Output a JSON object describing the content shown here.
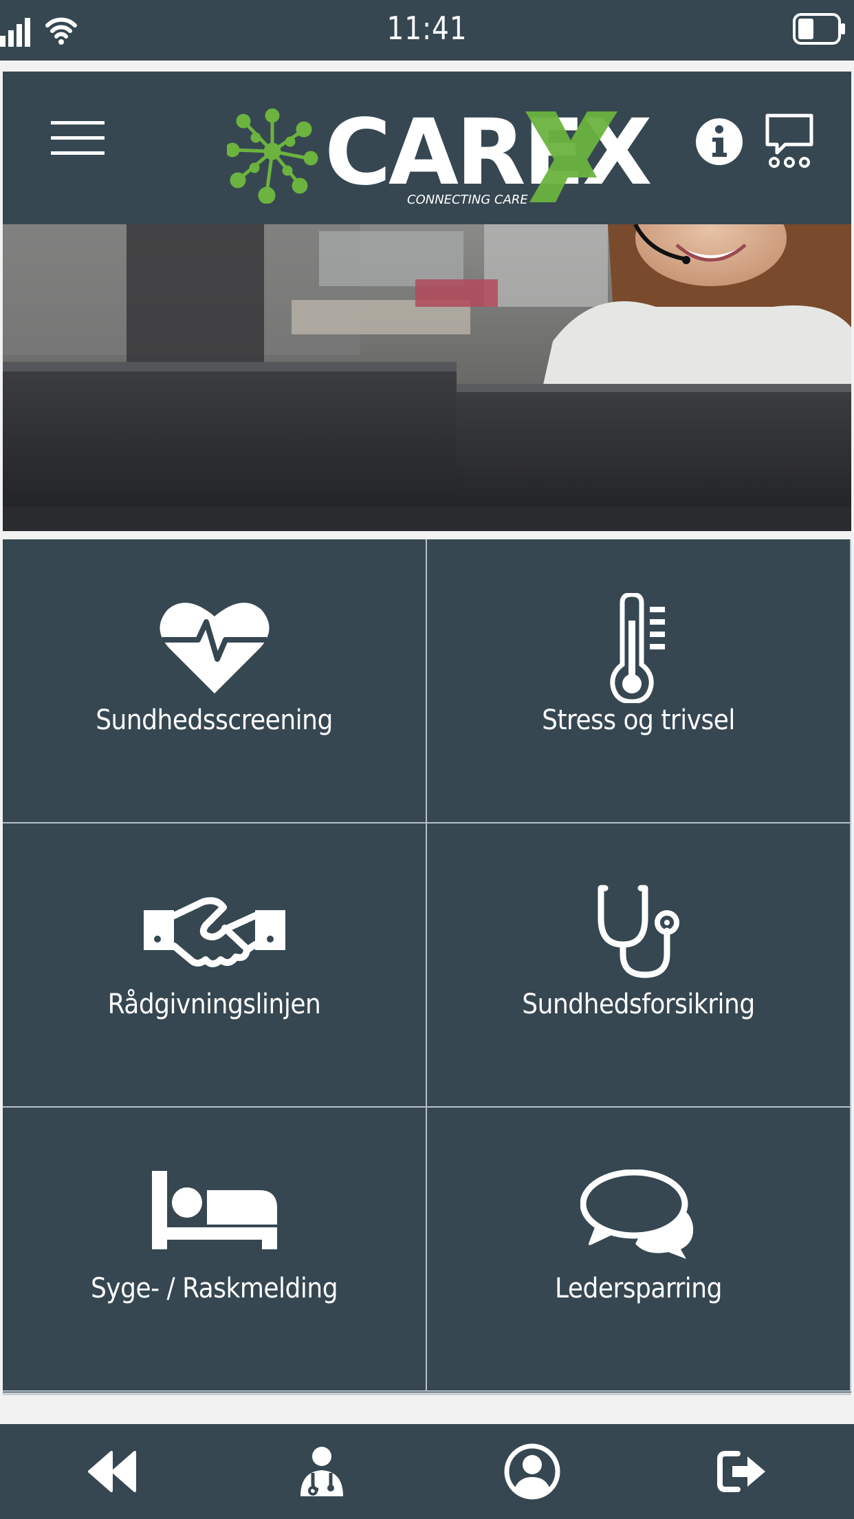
{
  "status_bar": {
    "time": "11:41"
  },
  "header": {
    "logo": {
      "word": "CAREX",
      "tagline": "CONNECTING CARE"
    }
  },
  "tiles": [
    {
      "label": "Sundhedsscreening",
      "icon": "heart-pulse-icon"
    },
    {
      "label": "Stress og trivsel",
      "icon": "thermometer-icon"
    },
    {
      "label": "Rådgivningslinjen",
      "icon": "handshake-icon"
    },
    {
      "label": "Sundhedsforsikring",
      "icon": "stethoscope-icon"
    },
    {
      "label": "Syge- / Raskmelding",
      "icon": "bed-icon"
    },
    {
      "label": "Ledersparring",
      "icon": "chat-bubbles-icon"
    }
  ],
  "tabbar": {
    "items": [
      "back-icon",
      "doctor-icon",
      "user-icon",
      "logout-icon"
    ]
  },
  "colors": {
    "primary": "#364751",
    "accent_green": "#6cb33f",
    "text": "#ffffff",
    "divider": "#b7c1c7"
  }
}
